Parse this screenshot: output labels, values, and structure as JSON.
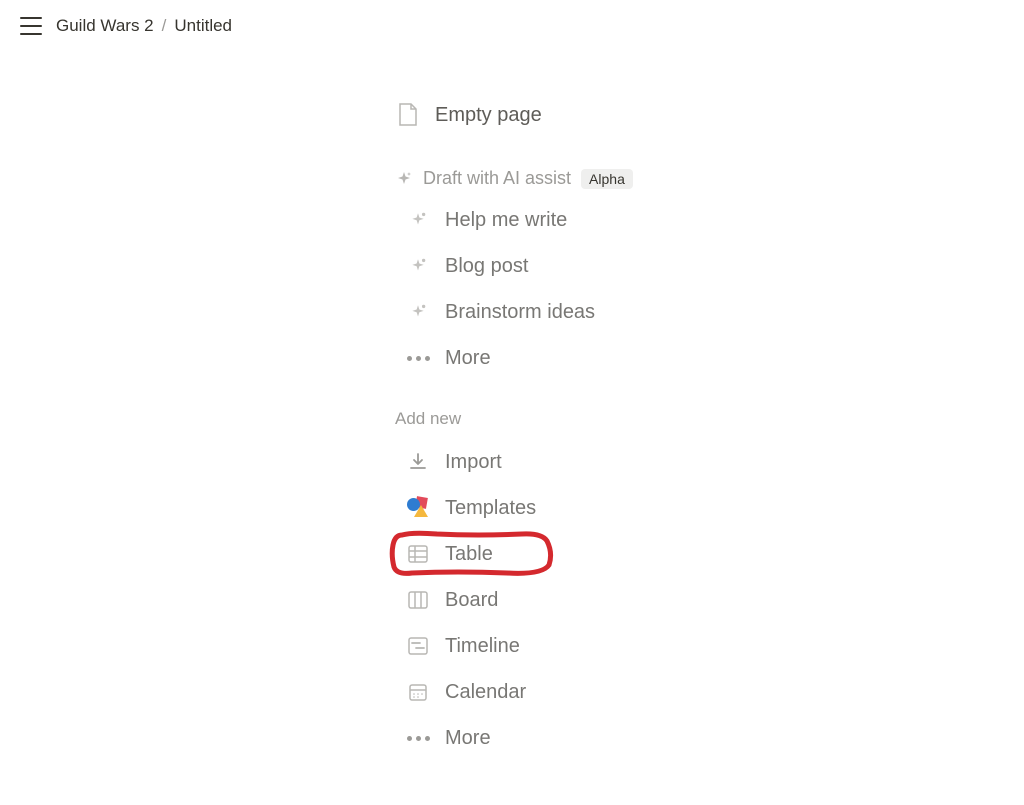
{
  "breadcrumb": {
    "parent": "Guild Wars 2",
    "separator": "/",
    "current": "Untitled"
  },
  "emptyPage": {
    "label": "Empty page"
  },
  "aiSection": {
    "title": "Draft with AI assist",
    "badge": "Alpha",
    "items": [
      {
        "label": "Help me write"
      },
      {
        "label": "Blog post"
      },
      {
        "label": "Brainstorm ideas"
      },
      {
        "label": "More"
      }
    ]
  },
  "addNew": {
    "title": "Add new",
    "items": [
      {
        "label": "Import"
      },
      {
        "label": "Templates"
      },
      {
        "label": "Table"
      },
      {
        "label": "Board"
      },
      {
        "label": "Timeline"
      },
      {
        "label": "Calendar"
      },
      {
        "label": "More"
      }
    ]
  }
}
